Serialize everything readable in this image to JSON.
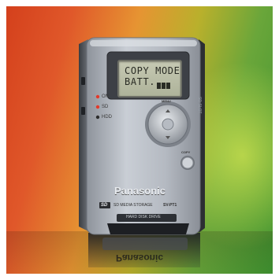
{
  "device": {
    "brand": "Panasonic",
    "model": "SV-PT1",
    "sd_logo": "SD",
    "media_text": "SD MEDIA STORAGE",
    "hdd_label": "HARD DISK DRIVE",
    "lcd": {
      "line1": "COPY MODE",
      "line2": "BATT.",
      "battery_level": 0.75
    },
    "leds": [
      {
        "label": "ON",
        "color": "#e23a2a"
      },
      {
        "label": "SD",
        "color": "#e23a2a"
      },
      {
        "label": "HDD",
        "color": "#2c2c2c"
      }
    ],
    "menu_label": "MENU",
    "copy_label": "COPY",
    "side_label": "SD SLOT"
  },
  "colors": {
    "body": "#b9bec6",
    "background_left": "#d4401c",
    "background_right": "#3f9330"
  }
}
